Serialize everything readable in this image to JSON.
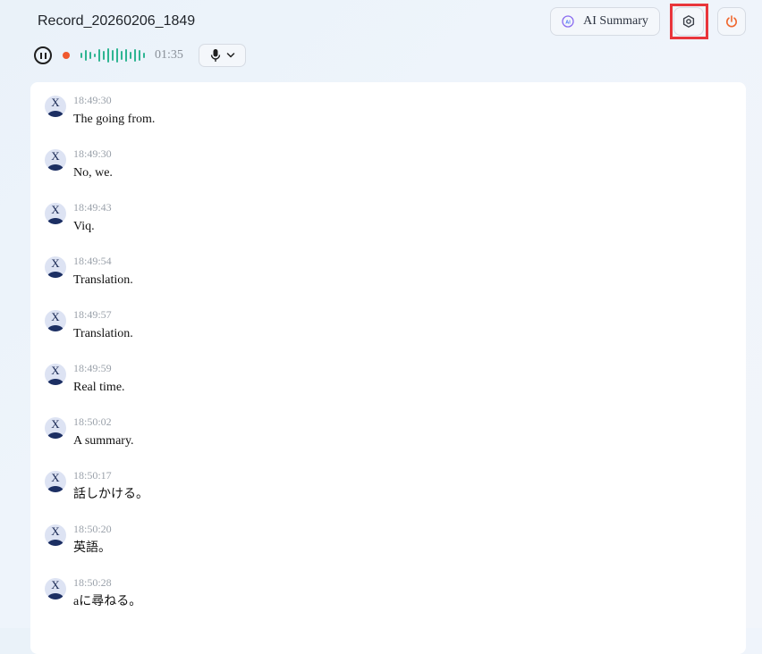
{
  "header": {
    "title": "Record_20260206_1849",
    "ai_summary_label": "AI Summary",
    "ai_icon_text": "AI"
  },
  "recorder": {
    "duration": "01:35",
    "status": "recording"
  },
  "icons": {
    "ai": "ai-sparkle-icon",
    "settings": "gear-icon",
    "power": "power-icon",
    "pause": "pause-icon",
    "mic": "microphone-icon",
    "dropdown": "chevron-down-icon",
    "avatar": "user-avatar-icon"
  },
  "colors": {
    "power": "#f0672e",
    "record_dot": "#f0592e",
    "waveform": "#2fb592",
    "highlight": "#e8353b",
    "avatar_bg": "#dde3f3",
    "avatar_fg": "#1c2f63"
  },
  "transcript": [
    {
      "speaker": "X",
      "time": "18:49:30",
      "text": "The going from."
    },
    {
      "speaker": "X",
      "time": "18:49:30",
      "text": "No, we."
    },
    {
      "speaker": "X",
      "time": "18:49:43",
      "text": "Viq."
    },
    {
      "speaker": "X",
      "time": "18:49:54",
      "text": "Translation."
    },
    {
      "speaker": "X",
      "time": "18:49:57",
      "text": "Translation."
    },
    {
      "speaker": "X",
      "time": "18:49:59",
      "text": "Real time."
    },
    {
      "speaker": "X",
      "time": "18:50:02",
      "text": "A summary."
    },
    {
      "speaker": "X",
      "time": "18:50:17",
      "text": "話しかける。"
    },
    {
      "speaker": "X",
      "time": "18:50:20",
      "text": "英語。"
    },
    {
      "speaker": "X",
      "time": "18:50:28",
      "text": "aに尋ねる。"
    }
  ]
}
